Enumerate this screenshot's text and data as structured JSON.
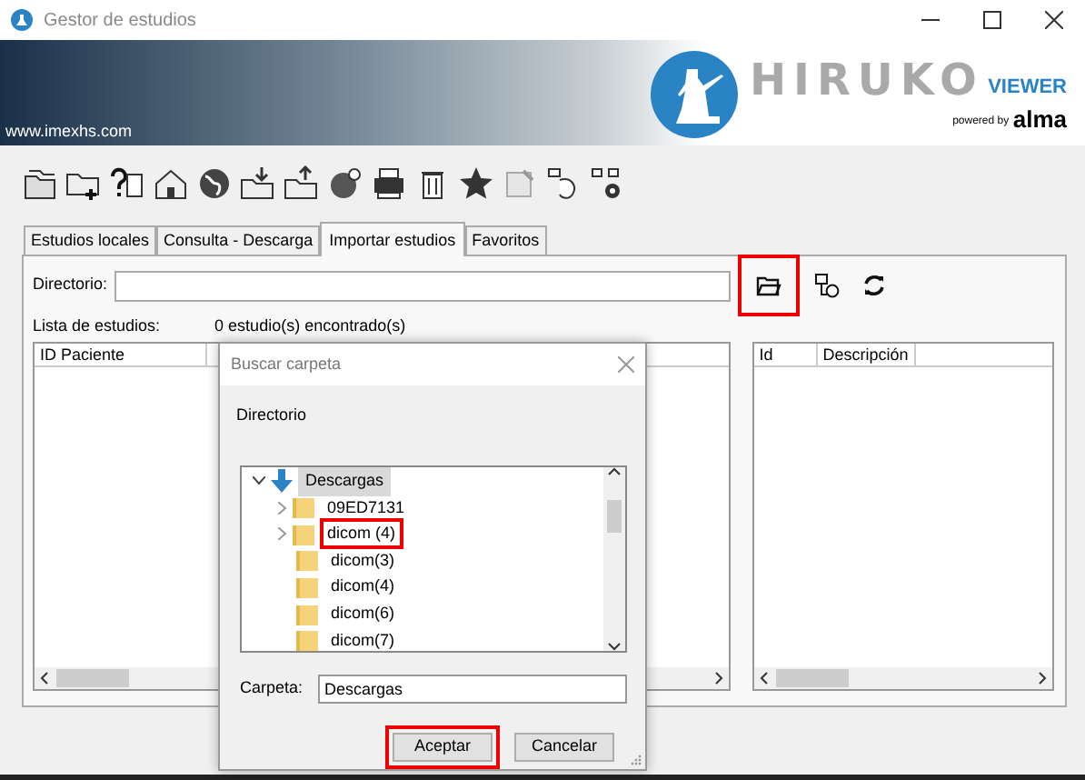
{
  "window": {
    "title": "Gestor de estudios"
  },
  "banner": {
    "website": "www.imexhs.com",
    "brand": "HIRUKO",
    "product": "VIEWER",
    "powered_by": "powered by",
    "partner": "alma"
  },
  "tabs": [
    {
      "label": "Estudios locales",
      "selected": false
    },
    {
      "label": "Consulta - Descarga",
      "selected": false
    },
    {
      "label": "Importar estudios",
      "selected": true
    },
    {
      "label": "Favoritos",
      "selected": false
    }
  ],
  "directory": {
    "label": "Directorio:",
    "browse_highlighted": true
  },
  "study_list": {
    "label": "Lista de estudios:",
    "count": "0 estudio(s) encontrado(s)",
    "columns": [
      "ID Paciente"
    ]
  },
  "series_table": {
    "columns": [
      "Id",
      "Descripción"
    ]
  },
  "dialog": {
    "title": "Buscar carpeta",
    "heading": "Directorio",
    "tree": [
      {
        "label": "Descargas",
        "expanded": true,
        "selected": true,
        "highlighted": false,
        "children": [
          {
            "label": "09ED7131",
            "expandable": true,
            "selected": false,
            "highlighted": false
          },
          {
            "label": "dicom (4)",
            "expandable": true,
            "selected": false,
            "highlighted": true
          },
          {
            "label": "dicom(3)",
            "expandable": false,
            "selected": false,
            "highlighted": false
          },
          {
            "label": "dicom(4)",
            "expandable": false,
            "selected": false,
            "highlighted": false
          },
          {
            "label": "dicom(6)",
            "expandable": false,
            "selected": false,
            "highlighted": false
          },
          {
            "label": "dicom(7)",
            "expandable": false,
            "selected": false,
            "highlighted": false
          }
        ]
      }
    ],
    "folder_label": "Carpeta:",
    "folder_value": "Descargas",
    "buttons": [
      {
        "label": "Aceptar",
        "highlighted": true
      },
      {
        "label": "Cancelar",
        "highlighted": false
      }
    ]
  }
}
